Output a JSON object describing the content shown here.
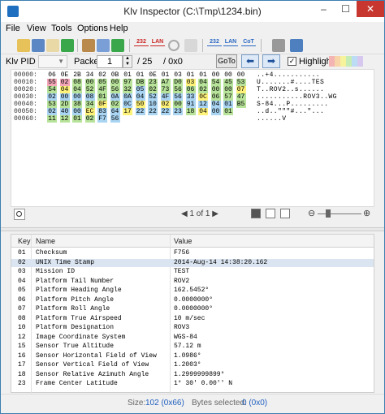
{
  "window": {
    "title": "Klv Inspector (C:\\Tmp\\1234.bin)",
    "minimize": "–",
    "maximize": "☐",
    "close": "✕"
  },
  "menu": [
    "File",
    "View",
    "Tools",
    "Options",
    "Help"
  ],
  "toolbar": {
    "icons": [
      "open-folder-icon",
      "save-icon",
      "open-file-icon",
      "export-icon",
      "settings-icon",
      "edit-icon",
      "run-icon",
      "udp-232-icon",
      "lan-icon",
      "disconnect-icon",
      "record-icon",
      "udp-232-out-icon",
      "lan-out-icon",
      "cot-icon",
      "tools-icon",
      "window-icon"
    ],
    "label_232": "232",
    "label_lan": "LAN",
    "label_232b": "232",
    "label_lanb": "LAN",
    "label_cot": "CoT"
  },
  "packet_bar": {
    "klv_pid_label": "Klv PID",
    "packet_label": "Packet",
    "packet_value": "1",
    "total": "/ 25",
    "offset": "/ 0x0",
    "goto_label": "GoTo",
    "highlight_label": "Highlight",
    "highlight_checked": true,
    "highlight_colors": [
      "#f4b4b4",
      "#f7d5a8",
      "#f7f29c",
      "#c4ecb4",
      "#bcdcf5",
      "#d6c8ef"
    ]
  },
  "hex": {
    "rows": [
      {
        "offset": "00000:",
        "ascii": "..+4..........."
      },
      {
        "offset": "00010:",
        "ascii": "U.......#....TES"
      },
      {
        "offset": "00020:",
        "ascii": "T..ROV2..s......"
      },
      {
        "offset": "00030:",
        "ascii": "...........ROV3..WG"
      },
      {
        "offset": "00040:",
        "ascii": "S-84...P........."
      },
      {
        "offset": "00050:",
        "ascii": "..d..\"\"\"#...\"..."
      },
      {
        "offset": "00060:",
        "ascii": "......V"
      }
    ],
    "bytes": [
      [
        "06",
        "0E",
        "2B",
        "34",
        "02",
        "0B",
        "01",
        "01",
        "0E",
        "01",
        "03",
        "01",
        "01",
        "00",
        "00",
        "00"
      ],
      [
        "55",
        "02",
        "08",
        "00",
        "05",
        "00",
        "97",
        "DB",
        "23",
        "A7",
        "D0",
        "03",
        "04",
        "54",
        "45",
        "53"
      ],
      [
        "54",
        "04",
        "04",
        "52",
        "4F",
        "56",
        "32",
        "05",
        "02",
        "73",
        "56",
        "06",
        "02",
        "00",
        "00",
        "07"
      ],
      [
        "02",
        "00",
        "00",
        "08",
        "01",
        "0A",
        "0A",
        "04",
        "52",
        "4F",
        "56",
        "33",
        "0C",
        "06",
        "57",
        "47"
      ],
      [
        "53",
        "2D",
        "38",
        "34",
        "0F",
        "02",
        "0C",
        "50",
        "10",
        "02",
        "00",
        "91",
        "12",
        "04",
        "01",
        "B5"
      ],
      [
        "02",
        "40",
        "00",
        "EC",
        "83",
        "64",
        "17",
        "22",
        "22",
        "22",
        "23",
        "18",
        "04",
        "00",
        "01"
      ],
      [
        "11",
        "12",
        "01",
        "02",
        "F7",
        "56"
      ]
    ],
    "row_colors": [
      [
        "none",
        "none",
        "none",
        "none",
        "none",
        "none",
        "none",
        "none",
        "none",
        "none",
        "none",
        "none",
        "none",
        "none",
        "none",
        "none"
      ],
      [
        "pink",
        "pink",
        "green",
        "green",
        "green",
        "green",
        "green",
        "green",
        "green",
        "green",
        "green",
        "yellow",
        "green",
        "green",
        "green",
        "green"
      ],
      [
        "green",
        "yellow",
        "green",
        "green",
        "green",
        "green",
        "green",
        "blue",
        "green",
        "green",
        "green",
        "green",
        "green",
        "green",
        "green",
        "yellow"
      ],
      [
        "blue",
        "blue",
        "blue",
        "blue",
        "green",
        "blue",
        "blue",
        "blue",
        "blue",
        "blue",
        "blue",
        "blue",
        "yellow",
        "green",
        "green",
        "green"
      ],
      [
        "green",
        "green",
        "green",
        "green",
        "yellow",
        "green",
        "blue",
        "yellow",
        "blue",
        "yellow",
        "green",
        "blue",
        "blue",
        "blue",
        "blue",
        "green"
      ],
      [
        "blue",
        "blue",
        "blue",
        "yellow",
        "blue",
        "blue",
        "yellow",
        "blue",
        "blue",
        "blue",
        "blue",
        "green",
        "yellow",
        "blue",
        "green"
      ],
      [
        "green",
        "green",
        "green",
        "green",
        "blue",
        "blue"
      ]
    ],
    "pager": "1 of 1"
  },
  "grid": {
    "headers": {
      "key": "Key",
      "name": "Name",
      "value": "Value"
    },
    "rows": [
      {
        "key": "01",
        "name": "Checksum",
        "value": "F756"
      },
      {
        "key": "02",
        "name": "UNIX Time Stamp",
        "value": "2014-Aug-14 14:38:20.162"
      },
      {
        "key": "03",
        "name": "Mission ID",
        "value": "TEST"
      },
      {
        "key": "04",
        "name": "Platform Tail Number",
        "value": "ROV2"
      },
      {
        "key": "05",
        "name": "Platform Heading Angle",
        "value": "162.5452°"
      },
      {
        "key": "06",
        "name": "Platform Pitch Angle",
        "value": "0.0000000°"
      },
      {
        "key": "07",
        "name": "Platform Roll Angle",
        "value": "0.0000000°"
      },
      {
        "key": "08",
        "name": "Platform True Airspeed",
        "value": "10 m/sec"
      },
      {
        "key": "10",
        "name": "Platform Designation",
        "value": "ROV3"
      },
      {
        "key": "12",
        "name": "Image Coordinate System",
        "value": "WGS-84"
      },
      {
        "key": "15",
        "name": "Sensor True Altitude",
        "value": "57.12 m"
      },
      {
        "key": "16",
        "name": "Sensor Horizontal Field of View",
        "value": "1.0986°"
      },
      {
        "key": "17",
        "name": "Sensor Vertical Field of View",
        "value": "1.2003°"
      },
      {
        "key": "18",
        "name": "Sensor Relative Azimuth Angle",
        "value": "1.2999999899°"
      },
      {
        "key": "23",
        "name": "Frame Center Latitude",
        "value": "1° 30' 0.00'' N"
      }
    ],
    "selected_index": 1
  },
  "status": {
    "size_label": "Size:",
    "size_value": "102 (0x66)",
    "bytes_label": "Bytes selected:",
    "bytes_value": "0 (0x0)"
  }
}
